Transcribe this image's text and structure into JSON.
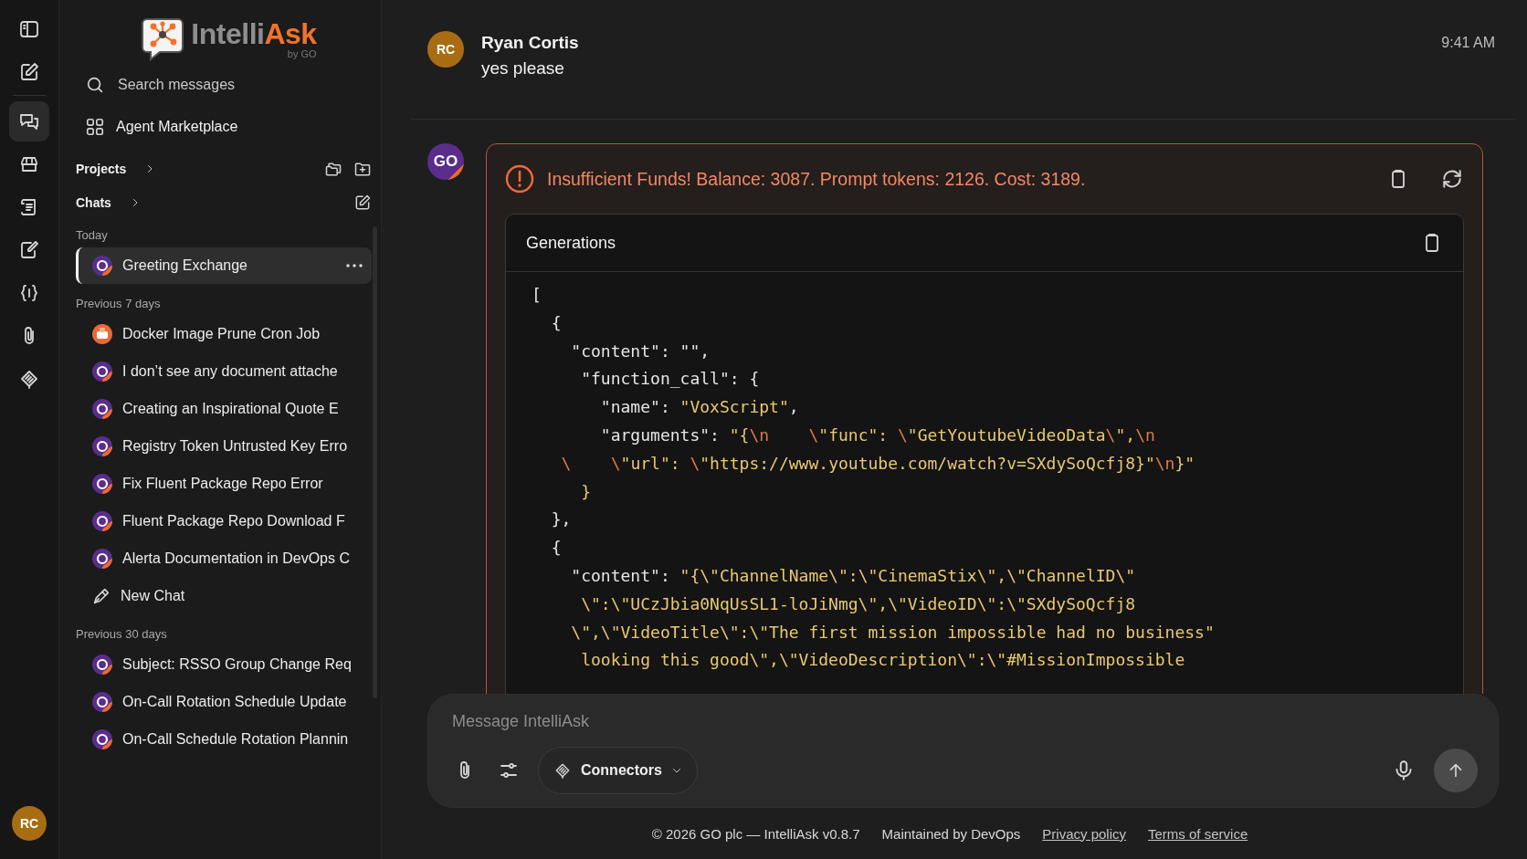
{
  "rail": {
    "items": [
      {
        "selected": false
      },
      {
        "selected": false
      },
      {
        "selected": true
      },
      {
        "selected": false
      },
      {
        "selected": false
      },
      {
        "selected": false
      },
      {
        "selected": false
      },
      {
        "selected": false
      },
      {
        "selected": false
      }
    ],
    "user_initials": "RC"
  },
  "sidebar": {
    "logo": {
      "name": "Intelli",
      "accent": "Ask",
      "byline": "by GO"
    },
    "search": {
      "placeholder": "Search messages"
    },
    "marketplace": "Agent Marketplace",
    "projects": "Projects",
    "chats": "Chats",
    "groups": [
      {
        "label": "Today",
        "items": [
          {
            "title": "Greeting Exchange",
            "kind": "go",
            "selected": true
          }
        ]
      },
      {
        "label": "Previous 7 days",
        "items": [
          {
            "title": "Docker Image Prune Cron Job",
            "kind": "docker",
            "selected": false
          },
          {
            "title": "I don’t see any document attache",
            "kind": "go",
            "selected": false
          },
          {
            "title": "Creating an Inspirational Quote E",
            "kind": "go",
            "selected": false
          },
          {
            "title": "Registry Token Untrusted Key Erro",
            "kind": "go",
            "selected": false
          },
          {
            "title": "Fix Fluent Package Repo Error",
            "kind": "go",
            "selected": false
          },
          {
            "title": "Fluent Package Repo Download F",
            "kind": "go",
            "selected": false
          },
          {
            "title": "Alerta Documentation in DevOps C",
            "kind": "go",
            "selected": false
          },
          {
            "title": "New Chat",
            "kind": "pen",
            "selected": false
          }
        ]
      },
      {
        "label": "Previous 30 days",
        "items": [
          {
            "title": "Subject: RSSO Group Change Req",
            "kind": "go",
            "selected": false
          },
          {
            "title": "On-Call Rotation Schedule Update",
            "kind": "go",
            "selected": false
          },
          {
            "title": "On-Call Schedule Rotation Plannin",
            "kind": "go",
            "selected": false
          }
        ]
      }
    ]
  },
  "conversation": {
    "user_message": {
      "initials": "RC",
      "author": "Ryan Cortis",
      "text": "yes please",
      "time": "9:41 AM"
    },
    "reply": {
      "avatar": "GO",
      "error": "Insufficient Funds! Balance: 3087. Prompt tokens: 2126. Cost: 3189.",
      "panel_title": "Generations",
      "code": [
        [
          {
            "kind": "plain",
            "text": "["
          }
        ],
        [
          {
            "kind": "plain",
            "text": "  {"
          }
        ],
        [
          {
            "kind": "plain",
            "text": "    \"content\": \"\","
          }
        ],
        [
          {
            "kind": "plain",
            "text": "     \"function_call\": {"
          }
        ],
        [
          {
            "kind": "plain",
            "text": "       \"name\": "
          },
          {
            "kind": "string",
            "text": "\"VoxScript\""
          },
          {
            "kind": "plain",
            "text": ","
          }
        ],
        [
          {
            "kind": "plain",
            "text": "       \"arguments\": "
          },
          {
            "kind": "string",
            "text": "\"{"
          },
          {
            "kind": "escape",
            "text": "\\n    \\"
          },
          {
            "kind": "string",
            "text": "\"func\": "
          },
          {
            "kind": "escape",
            "text": "\\"
          },
          {
            "kind": "string",
            "text": "\"GetYoutubeVideoData"
          },
          {
            "kind": "escape",
            "text": "\\"
          },
          {
            "kind": "string",
            "text": "\","
          },
          {
            "kind": "escape",
            "text": "\\n"
          }
        ],
        [
          {
            "kind": "escape",
            "text": "   \\    \\"
          },
          {
            "kind": "string",
            "text": "\"url\": "
          },
          {
            "kind": "escape",
            "text": "\\"
          },
          {
            "kind": "string",
            "text": "\"https://www.youtube.com/watch?v=SXdySoQcfj8}\""
          },
          {
            "kind": "escape",
            "text": "\\n"
          },
          {
            "kind": "string",
            "text": "}\""
          }
        ],
        [
          {
            "kind": "string",
            "text": "     }"
          }
        ],
        [
          {
            "kind": "plain",
            "text": "  },"
          }
        ],
        [
          {
            "kind": "plain",
            "text": "  {"
          }
        ],
        [
          {
            "kind": "plain",
            "text": "    \"content\": "
          },
          {
            "kind": "string",
            "text": "\"{\\\"ChannelName\\\":\\\"CinemaStix\\\",\\\"ChannelID\\\""
          }
        ],
        [
          {
            "kind": "string",
            "text": "     \\\":\\\"UCzJbia0NqUsSL1-loJiNmg\\\",\\\"VideoID\\\":\\\"SXdySoQcfj8"
          }
        ],
        [
          {
            "kind": "string",
            "text": "    \\\",\\\"VideoTitle\\\":\\\"The first mission impossible had no business\""
          }
        ],
        [
          {
            "kind": "string",
            "text": "     looking this good\\\",\\\"VideoDescription\\\":\\\"#MissionImpossible"
          }
        ]
      ]
    }
  },
  "composer": {
    "placeholder": "Message IntelliAsk",
    "connectors": "Connectors"
  },
  "footer": {
    "copyright": "© 2026 GO plc — IntelliAsk v0.8.7",
    "maintainer": "Maintained by DevOps",
    "links": [
      "Privacy policy",
      "Terms of service"
    ]
  }
}
